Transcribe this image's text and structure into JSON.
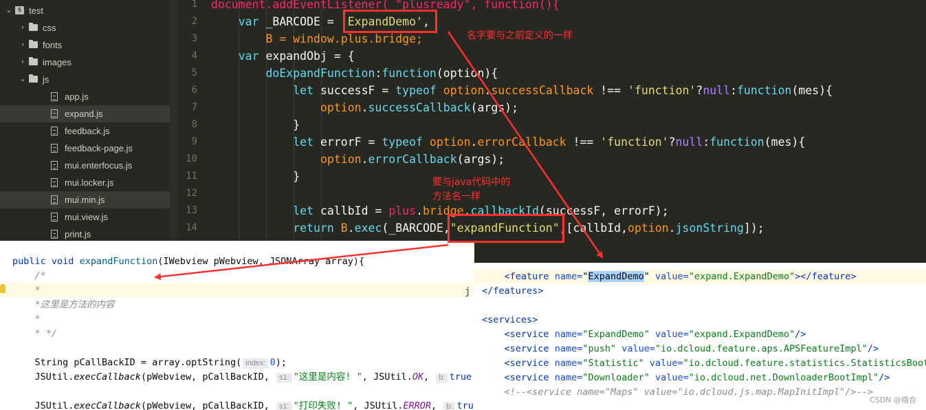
{
  "sidebar": {
    "project": "test",
    "items": [
      {
        "label": "css",
        "type": "folder",
        "open": false
      },
      {
        "label": "fonts",
        "type": "folder",
        "open": false
      },
      {
        "label": "images",
        "type": "folder",
        "open": false
      },
      {
        "label": "js",
        "type": "folder",
        "open": true
      },
      {
        "label": "app.js",
        "type": "file"
      },
      {
        "label": "expand.js",
        "type": "file",
        "selected": true
      },
      {
        "label": "feedback.js",
        "type": "file"
      },
      {
        "label": "feedback-page.js",
        "type": "file"
      },
      {
        "label": "mui.enterfocus.js",
        "type": "file"
      },
      {
        "label": "mui.locker.js",
        "type": "file"
      },
      {
        "label": "mui.min.js",
        "type": "file",
        "selected": true
      },
      {
        "label": "mui.view.js",
        "type": "file"
      },
      {
        "label": "print.js",
        "type": "file"
      }
    ]
  },
  "editor": {
    "line_numbers": [
      "1",
      "2",
      "3",
      "4",
      "5",
      "6",
      "7",
      "8",
      "9",
      "10",
      "11",
      "12",
      "13",
      "14"
    ],
    "lines": [
      [
        {
          "t": "document.addEventListener( \"plusready\", function(){",
          "c": "var"
        }
      ],
      [
        {
          "t": "    "
        },
        {
          "t": "var",
          "c": "kw"
        },
        {
          "t": " _BARCODE = "
        },
        {
          "t": "'ExpandDemo'",
          "c": "str"
        },
        {
          "t": ","
        }
      ],
      [
        {
          "t": "        B = window.plus.bridge;",
          "c": "org"
        }
      ],
      [
        {
          "t": "    "
        },
        {
          "t": "var",
          "c": "kw"
        },
        {
          "t": " expandObj = {"
        }
      ],
      [
        {
          "t": "        "
        },
        {
          "t": "doExpandFunction",
          "c": "cyan"
        },
        {
          "t": ":"
        },
        {
          "t": "function",
          "c": "kw"
        },
        {
          "t": "(option){"
        }
      ],
      [
        {
          "t": "            "
        },
        {
          "t": "let",
          "c": "kw"
        },
        {
          "t": " successF = "
        },
        {
          "t": "typeof",
          "c": "kw"
        },
        {
          "t": " "
        },
        {
          "t": "option",
          "c": "org"
        },
        {
          "t": "."
        },
        {
          "t": "successCallback",
          "c": "org"
        },
        {
          "t": " !== "
        },
        {
          "t": "'function'",
          "c": "str"
        },
        {
          "t": "?"
        },
        {
          "t": "null",
          "c": "kw2"
        },
        {
          "t": ":"
        },
        {
          "t": "function",
          "c": "kw"
        },
        {
          "t": "(mes){"
        }
      ],
      [
        {
          "t": "                "
        },
        {
          "t": "option",
          "c": "org"
        },
        {
          "t": "."
        },
        {
          "t": "successCallback",
          "c": "cyan"
        },
        {
          "t": "(args);"
        }
      ],
      [
        {
          "t": "            }"
        }
      ],
      [
        {
          "t": "            "
        },
        {
          "t": "let",
          "c": "kw"
        },
        {
          "t": " errorF = "
        },
        {
          "t": "typeof",
          "c": "kw"
        },
        {
          "t": " "
        },
        {
          "t": "option",
          "c": "org"
        },
        {
          "t": "."
        },
        {
          "t": "errorCallback",
          "c": "org"
        },
        {
          "t": " !== "
        },
        {
          "t": "'function'",
          "c": "str"
        },
        {
          "t": "?"
        },
        {
          "t": "null",
          "c": "kw2"
        },
        {
          "t": ":"
        },
        {
          "t": "function",
          "c": "kw"
        },
        {
          "t": "(mes){"
        }
      ],
      [
        {
          "t": "                "
        },
        {
          "t": "option",
          "c": "org"
        },
        {
          "t": "."
        },
        {
          "t": "errorCallback",
          "c": "cyan"
        },
        {
          "t": "(args);"
        }
      ],
      [
        {
          "t": "            }"
        }
      ],
      [
        {
          "t": ""
        }
      ],
      [
        {
          "t": "            "
        },
        {
          "t": "let",
          "c": "kw"
        },
        {
          "t": " callbId = "
        },
        {
          "t": "plus",
          "c": "var"
        },
        {
          "t": "."
        },
        {
          "t": "bridge",
          "c": "org"
        },
        {
          "t": "."
        },
        {
          "t": "callbackId",
          "c": "cyan"
        },
        {
          "t": "(successF, errorF);"
        }
      ],
      [
        {
          "t": "            "
        },
        {
          "t": "return",
          "c": "kw"
        },
        {
          "t": " "
        },
        {
          "t": "B",
          "c": "org"
        },
        {
          "t": "."
        },
        {
          "t": "exec",
          "c": "cyan"
        },
        {
          "t": "(_BARCODE,"
        },
        {
          "t": "\"expandFunction\"",
          "c": "str"
        },
        {
          "t": ",[callbId,"
        },
        {
          "t": "option",
          "c": "org"
        },
        {
          "t": "."
        },
        {
          "t": "jsonString",
          "c": "cyan"
        },
        {
          "t": "]);"
        }
      ]
    ]
  },
  "annotations": {
    "note1": "名字要与之前定义的一样",
    "note2_line1": "要与java代码中的",
    "note2_line2": "方法名一样",
    "stray_j": "j"
  },
  "java": {
    "lines": [
      [
        {
          "t": "public",
          "c": "jkw"
        },
        {
          "t": " "
        },
        {
          "t": "void",
          "c": "jkw"
        },
        {
          "t": " "
        },
        {
          "t": "expandFunction",
          "c": "jfn"
        },
        {
          "t": "(IWebview pWebview, JSONArray array){"
        }
      ],
      [
        {
          "t": "    /*",
          "c": "jcom"
        }
      ],
      [
        {
          "t": "    *",
          "c": "jcom"
        }
      ],
      [
        {
          "t": "    *这里是方法的内容",
          "c": "jcom"
        }
      ],
      [
        {
          "t": "    *",
          "c": "jcom"
        }
      ],
      [
        {
          "t": "    * */",
          "c": "jcom"
        }
      ],
      [
        {
          "t": ""
        }
      ],
      [
        {
          "t": "    String pCallBackID = array.optString("
        },
        {
          "t": "index:",
          "c": "hint"
        },
        {
          "t": "0",
          "c": "jnum"
        },
        {
          "t": ");"
        }
      ],
      [
        {
          "t": "    JSUtil."
        },
        {
          "t": "execCallback",
          "c": "jit"
        },
        {
          "t": "(pWebview, pCallBackID, "
        },
        {
          "t": "s1:",
          "c": "hint"
        },
        {
          "t": "\"这里是内容! \"",
          "c": "jstr"
        },
        {
          "t": ", JSUtil."
        },
        {
          "t": "OK",
          "c": "jconst"
        },
        {
          "t": ", "
        },
        {
          "t": "b:",
          "c": "hint"
        },
        {
          "t": "true",
          "c": "jkw"
        }
      ],
      [
        {
          "t": ""
        }
      ],
      [
        {
          "t": "    JSUtil."
        },
        {
          "t": "execCallback",
          "c": "jit"
        },
        {
          "t": "(pWebview, pCallBackID, "
        },
        {
          "t": "s1:",
          "c": "hint"
        },
        {
          "t": "\"打印失败! \"",
          "c": "jstr"
        },
        {
          "t": ", JSUtil."
        },
        {
          "t": "ERROR",
          "c": "jconst"
        },
        {
          "t": ", "
        },
        {
          "t": "b:",
          "c": "hint"
        },
        {
          "t": "true",
          "c": "jkw"
        }
      ]
    ]
  },
  "xml": {
    "lines": [
      [
        {
          "t": "    "
        },
        {
          "t": "<feature",
          "c": "xtag"
        },
        {
          "t": " "
        },
        {
          "t": "name=",
          "c": "xattr"
        },
        {
          "t": "\""
        },
        {
          "t": "ExpandDemo",
          "c": "xsel"
        },
        {
          "t": "\""
        },
        {
          "t": " "
        },
        {
          "t": "value=",
          "c": "xattr"
        },
        {
          "t": "\"expand.ExpandDemo\"",
          "c": "xval"
        },
        {
          "t": "></feature>",
          "c": "xtag"
        }
      ],
      [
        {
          "t": "</features>",
          "c": "xtag"
        }
      ],
      [
        {
          "t": ""
        }
      ],
      [
        {
          "t": "<services>",
          "c": "xtag"
        }
      ],
      [
        {
          "t": "    "
        },
        {
          "t": "<service",
          "c": "xtag"
        },
        {
          "t": " "
        },
        {
          "t": "name=",
          "c": "xattr"
        },
        {
          "t": "\"ExpandDemo\"",
          "c": "xval"
        },
        {
          "t": " "
        },
        {
          "t": "value=",
          "c": "xattr"
        },
        {
          "t": "\"expand.ExpandDemo\"",
          "c": "xval"
        },
        {
          "t": "/>",
          "c": "xtag"
        }
      ],
      [
        {
          "t": "    "
        },
        {
          "t": "<service",
          "c": "xtag"
        },
        {
          "t": " "
        },
        {
          "t": "name=",
          "c": "xattr"
        },
        {
          "t": "\"push\"",
          "c": "xval"
        },
        {
          "t": " "
        },
        {
          "t": "value=",
          "c": "xattr"
        },
        {
          "t": "\"io.dcloud.feature.aps.APSFeatureImpl\"",
          "c": "xval"
        },
        {
          "t": "/>",
          "c": "xtag"
        }
      ],
      [
        {
          "t": "    "
        },
        {
          "t": "<service",
          "c": "xtag"
        },
        {
          "t": " "
        },
        {
          "t": "name=",
          "c": "xattr"
        },
        {
          "t": "\"Statistic\"",
          "c": "xval"
        },
        {
          "t": " "
        },
        {
          "t": "value=",
          "c": "xattr"
        },
        {
          "t": "\"io.dcloud.feature.statistics.StatisticsBootImpl\"",
          "c": "xval"
        },
        {
          "t": "/>",
          "c": "xtag"
        }
      ],
      [
        {
          "t": "    "
        },
        {
          "t": "<service",
          "c": "xtag"
        },
        {
          "t": " "
        },
        {
          "t": "name=",
          "c": "xattr"
        },
        {
          "t": "\"Downloader\"",
          "c": "xval"
        },
        {
          "t": " "
        },
        {
          "t": "value=",
          "c": "xattr"
        },
        {
          "t": "\"io.dcloud.net.DownloaderBootImpl\"",
          "c": "xval"
        },
        {
          "t": "/>",
          "c": "xtag"
        }
      ],
      [
        {
          "t": "    "
        },
        {
          "t": "<!--<service name=\"Maps\" value=\"io.dcloud.js.map.MapInitImpl\"/>-->",
          "c": "xcom"
        }
      ]
    ]
  },
  "watermark": "CSDN @络合",
  "colors": {
    "editor_bg": "#272822",
    "annotation_red": "#ff3030",
    "selection_blue": "#a6d2ff"
  }
}
